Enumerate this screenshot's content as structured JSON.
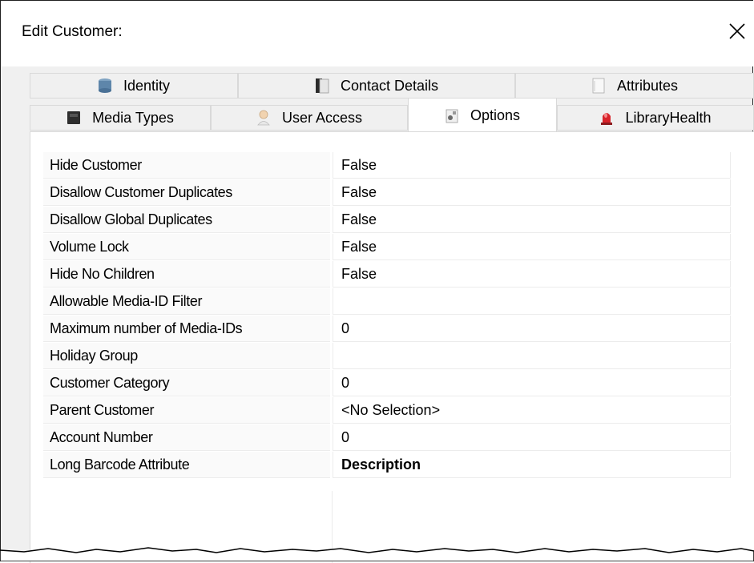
{
  "window": {
    "title": "Edit Customer:"
  },
  "tabs": {
    "row1": [
      {
        "label": "Identity",
        "icon": "identity-icon"
      },
      {
        "label": "Contact Details",
        "icon": "contact-details-icon"
      },
      {
        "label": "Attributes",
        "icon": "attributes-icon"
      }
    ],
    "row2": [
      {
        "label": "Media Types",
        "icon": "media-types-icon"
      },
      {
        "label": "User Access",
        "icon": "user-access-icon"
      },
      {
        "label": "Options",
        "icon": "options-icon"
      },
      {
        "label": "LibraryHealth",
        "icon": "library-health-icon"
      }
    ],
    "active": "Options"
  },
  "properties": [
    {
      "name": "Hide Customer",
      "value": "False"
    },
    {
      "name": "Disallow Customer Duplicates",
      "value": "False"
    },
    {
      "name": "Disallow Global Duplicates",
      "value": "False"
    },
    {
      "name": "Volume Lock",
      "value": "False"
    },
    {
      "name": "Hide No Children",
      "value": "False"
    },
    {
      "name": "Allowable Media-ID Filter",
      "value": ""
    },
    {
      "name": "Maximum number of Media-IDs",
      "value": "0"
    },
    {
      "name": "Holiday Group",
      "value": ""
    },
    {
      "name": "Customer Category",
      "value": "0"
    },
    {
      "name": "Parent Customer",
      "value": "<No Selection>"
    },
    {
      "name": "Account Number",
      "value": "0"
    },
    {
      "name": "Long Barcode Attribute",
      "value": "Description"
    }
  ],
  "colors": {
    "tab_background": "#f0f0f0",
    "panel_background": "#ffffff",
    "library_health_icon": "#d8232a"
  }
}
